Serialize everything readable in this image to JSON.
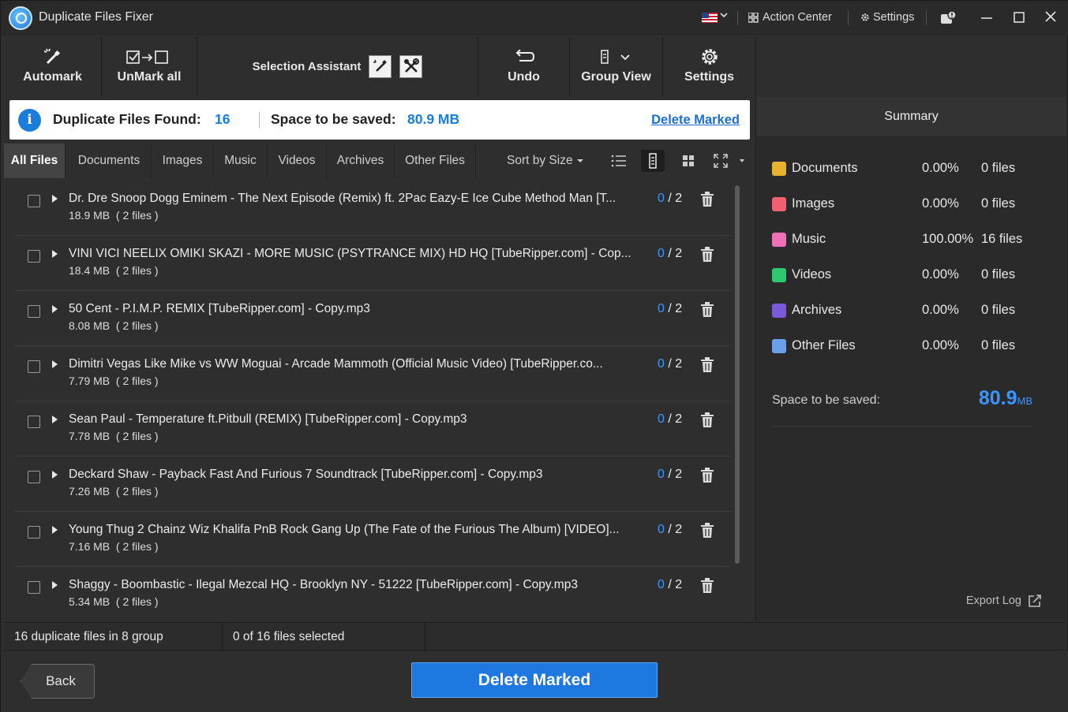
{
  "app": {
    "title": "Duplicate Files Fixer",
    "action_center": "Action Center",
    "settings": "Settings"
  },
  "toolbar": {
    "automark": "Automark",
    "unmark_all": "UnMark all",
    "selection_assistant": "Selection Assistant",
    "undo": "Undo",
    "group_view": "Group View",
    "settings": "Settings"
  },
  "banner": {
    "found_label": "Duplicate Files Found:",
    "found_count": "16",
    "space_label": "Space to be saved:",
    "space_value": "80.9 MB",
    "delete_marked_link": "Delete Marked"
  },
  "tabs": [
    "All Files",
    "Documents",
    "Images",
    "Music",
    "Videos",
    "Archives",
    "Other Files"
  ],
  "sort_label": "Sort by Size",
  "files": [
    {
      "name": "Dr. Dre Snoop Dogg Eminem - The Next Episode (Remix) ft. 2Pac Eazy-E Ice Cube Method Man [T...",
      "size": "18.9 MB",
      "count": "( 2 files )",
      "selected": "0",
      "total": "2"
    },
    {
      "name": "VINI VICI NEELIX OMIKI SKAZI - MORE MUSIC (PSYTRANCE MIX) HD HQ [TubeRipper.com] - Cop...",
      "size": "18.4 MB",
      "count": "( 2 files )",
      "selected": "0",
      "total": "2"
    },
    {
      "name": "50 Cent - P.I.M.P. REMIX [TubeRipper.com] - Copy.mp3",
      "size": "8.08 MB",
      "count": "( 2 files )",
      "selected": "0",
      "total": "2"
    },
    {
      "name": "Dimitri Vegas Like Mike vs WW Moguai - Arcade Mammoth (Official Music Video) [TubeRipper.co...",
      "size": "7.79 MB",
      "count": "( 2 files )",
      "selected": "0",
      "total": "2"
    },
    {
      "name": "Sean Paul - Temperature ft.Pitbull (REMIX) [TubeRipper.com] - Copy.mp3",
      "size": "7.78 MB",
      "count": "( 2 files )",
      "selected": "0",
      "total": "2"
    },
    {
      "name": "Deckard Shaw - Payback Fast And Furious 7 Soundtrack [TubeRipper.com] - Copy.mp3",
      "size": "7.26 MB",
      "count": "( 2 files )",
      "selected": "0",
      "total": "2"
    },
    {
      "name": "Young Thug 2 Chainz Wiz Khalifa PnB Rock Gang Up (The Fate of the Furious The Album) [VIDEO]...",
      "size": "7.16 MB",
      "count": "( 2 files )",
      "selected": "0",
      "total": "2"
    },
    {
      "name": "Shaggy - Boombastic - Ilegal Mezcal HQ - Brooklyn NY - 51222 [TubeRipper.com] - Copy.mp3",
      "size": "5.34 MB",
      "count": "( 2 files )",
      "selected": "0",
      "total": "2"
    }
  ],
  "summary": {
    "title": "Summary",
    "categories": [
      {
        "name": "Documents",
        "percent": "0.00%",
        "files": "0 files",
        "color": "#e8b230"
      },
      {
        "name": "Images",
        "percent": "0.00%",
        "files": "0 files",
        "color": "#f06070"
      },
      {
        "name": "Music",
        "percent": "100.00%",
        "files": "16 files",
        "color": "#f070b8"
      },
      {
        "name": "Videos",
        "percent": "0.00%",
        "files": "0 files",
        "color": "#2ec870"
      },
      {
        "name": "Archives",
        "percent": "0.00%",
        "files": "0 files",
        "color": "#7a5ad8"
      },
      {
        "name": "Other Files",
        "percent": "0.00%",
        "files": "0 files",
        "color": "#6aa0e8"
      }
    ],
    "space_label": "Space to be saved:",
    "space_value": "80.9",
    "space_unit": "MB",
    "export_log": "Export Log"
  },
  "status": {
    "groups": "16 duplicate files in 8 group",
    "selected": "0 of 16 files selected"
  },
  "footer": {
    "back": "Back",
    "delete_marked": "Delete Marked"
  },
  "colors": {
    "accent": "#1e78e0",
    "link_blue": "#3a96ff"
  }
}
